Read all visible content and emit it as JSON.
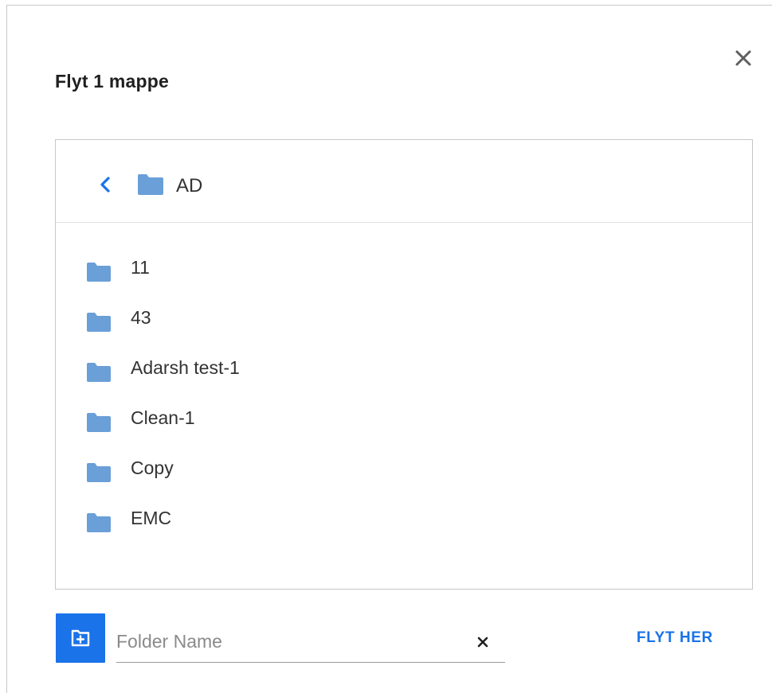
{
  "dialog": {
    "title": "Flyt 1 mappe"
  },
  "breadcrumb": {
    "current_folder": "AD"
  },
  "folders": [
    {
      "name": "11"
    },
    {
      "name": "43"
    },
    {
      "name": "Adarsh test-1"
    },
    {
      "name": "Clean-1"
    },
    {
      "name": "Copy"
    },
    {
      "name": "EMC"
    }
  ],
  "footer": {
    "folder_name_placeholder": "Folder Name",
    "folder_name_value": "",
    "move_here_label": "FLYT HER"
  },
  "icons": {
    "close": "close-icon",
    "back": "chevron-left-icon",
    "folder": "folder-icon",
    "new_folder": "add-folder-icon",
    "clear": "clear-icon"
  },
  "colors": {
    "accent": "#1a73e8",
    "folder": "#6a9fd8",
    "text": "#333333"
  }
}
